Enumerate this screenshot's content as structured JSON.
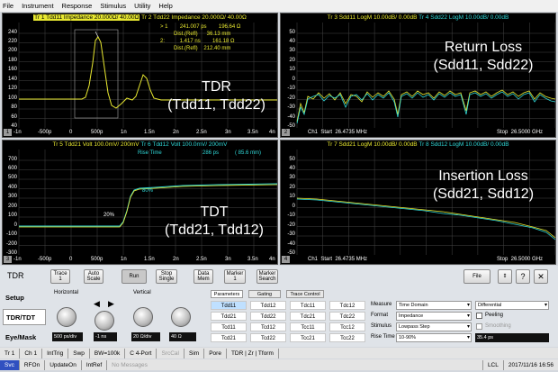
{
  "menu": [
    "File",
    "Instrument",
    "Response",
    "Stimulus",
    "Utility",
    "Help"
  ],
  "panels": {
    "p1": {
      "title1": "Tr 1  Tdd11 Impedance 20.000Ω/ 40.00Ω",
      "title2": "Tr 2  Tdd22 Impedance 20.000Ω/ 40.00Ω",
      "marker1": "> 1        241.007 ps        196.64 Ω",
      "marker1b": "Dist.(Refl)      36.13 mm",
      "marker2": "2:          1.417 ns        161.18 Ω",
      "marker2b": "Dist.(Refl)    212.40 mm",
      "overlay": "TDR\n(Tdd11, Tdd22)",
      "num": "1",
      "y_ticks": [
        "240",
        "220",
        "200",
        "180",
        "160",
        "140",
        "120",
        "100",
        "80",
        "60",
        "40"
      ],
      "x_ticks": [
        "-1n",
        "-500p",
        "0",
        "500p",
        "1n",
        "1.5n",
        "2n",
        "2.5n",
        "3n",
        "3.5n",
        "4n"
      ]
    },
    "p2": {
      "title1": "Tr 3  Sdd11 LogM 10.00dB/ 0.00dB",
      "title2": "Tr 4  Sdd22 LogM 10.00dB/ 0.00dB",
      "overlay": "Return Loss\n(Sdd11, Sdd22)",
      "num": "2",
      "y_ticks": [
        "50",
        "40",
        "30",
        "20",
        "10",
        "0",
        "-10",
        "-20",
        "-30",
        "-40",
        "-50"
      ],
      "start": "Ch1  Start  26.4735 MHz",
      "stop": "Stop  26.5000 GHz"
    },
    "p3": {
      "title1": "Tr 5  Tdd21 Volt 100.0mV/ 200mV",
      "title2": "Tr 6  Tdd12 Volt 100.0mV/ 200mV",
      "rise_label": "Rise Time",
      "rise_value": "286 ps",
      "rise_value2": "( 85.6 mm)",
      "m80": "80%",
      "m20": "20%",
      "overlay": "TDT\n(Tdd21, Tdd12)",
      "num": "3",
      "y_ticks": [
        "700",
        "600",
        "500",
        "400",
        "300",
        "200",
        "100",
        "0",
        "-100",
        "-200",
        "-300"
      ],
      "x_ticks": [
        "-1n",
        "-500p",
        "0",
        "500p",
        "1n",
        "1.5n",
        "2n",
        "2.5n",
        "3n",
        "3.5n",
        "4n"
      ]
    },
    "p4": {
      "title1": "Tr 7  Sdd21 LogM 10.00dB/ 0.00dB",
      "title2": "Tr 8  Sdd12 LogM 10.00dB/ 0.00dB",
      "overlay": "Insertion Loss\n(Sdd21, Sdd12)",
      "num": "4",
      "y_ticks": [
        "50",
        "40",
        "30",
        "20",
        "10",
        "0",
        "-10",
        "-20",
        "-30",
        "-40",
        "-50"
      ],
      "start": "Ch1  Start  26.4735 MHz",
      "stop": "Stop  26.5000 GHz"
    }
  },
  "controls": {
    "mode": "TDR",
    "buttons": [
      "Trace 1",
      "Auto Scale",
      "Run",
      "Stop Single",
      "Data Mem",
      "Marker 1",
      "Marker Search"
    ],
    "file": "File",
    "side": [
      "Setup",
      "TDR/TDT",
      "Eye/Mask"
    ],
    "horizontal": "Horizontal",
    "vertical": "Vertical",
    "fields": [
      "500 ps/div",
      "-1 ns",
      "20 Ω/div",
      "40 Ω"
    ],
    "tabs": [
      "Parameters",
      "Gating",
      "Trace Control"
    ],
    "grid": [
      [
        "Tdd11",
        "Tdd12",
        "Tdc11",
        "Tdc12"
      ],
      [
        "Tdd21",
        "Tdd22",
        "Tdc21",
        "Tdc22"
      ],
      [
        "Tcd11",
        "Tcd12",
        "Tcc11",
        "Tcc12"
      ],
      [
        "Tcd21",
        "Tcd22",
        "Tcc21",
        "Tcc22"
      ]
    ],
    "measure_label": "Measure",
    "measure_value": "Time Domain",
    "measure_value2": "Differential",
    "format_label": "Format",
    "format_value": "Impedance",
    "stimulus_label": "Stimulus",
    "stimulus_value": "Lowpass Step",
    "risetime_label": "Rise Time",
    "risetime_value": "10-90%",
    "risetime_value2": "35.4 ps",
    "peeling": "Peeling",
    "smoothing": "Smoothing"
  },
  "status1": [
    "Tr 1",
    "Ch 1",
    "IntTrig",
    "Swp",
    "BW=100k",
    "C 4-Port",
    "SrcCal",
    "Sim",
    "Pore",
    "TDR | Zr | Tform"
  ],
  "status2": [
    "Svc",
    "RFOn",
    "UpdateOn",
    "IntRef",
    "No Messages",
    "LCL",
    "2017/11/16 16:56"
  ],
  "colors": {
    "trace_yellow": "#e8e830",
    "trace_cyan": "#30d8d8",
    "grid": "#444444"
  }
}
